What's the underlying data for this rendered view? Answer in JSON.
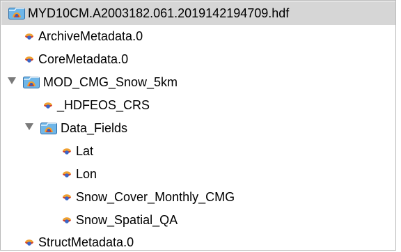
{
  "tree": {
    "items": [
      {
        "label": "MYD10CM.A2003182.061.2019142194709.hdf",
        "type": "file",
        "selected": true
      },
      {
        "label": "ArchiveMetadata.0",
        "type": "attribute"
      },
      {
        "label": "CoreMetadata.0",
        "type": "attribute"
      },
      {
        "label": "MOD_CMG_Snow_5km",
        "type": "group",
        "expanded": true
      },
      {
        "label": "_HDFEOS_CRS",
        "type": "attribute"
      },
      {
        "label": "Data_Fields",
        "type": "group",
        "expanded": true
      },
      {
        "label": "Lat",
        "type": "variable"
      },
      {
        "label": "Lon",
        "type": "variable"
      },
      {
        "label": "Snow_Cover_Monthly_CMG",
        "type": "variable"
      },
      {
        "label": "Snow_Spatial_QA",
        "type": "variable"
      },
      {
        "label": "StructMetadata.0",
        "type": "attribute"
      }
    ]
  },
  "icons": {
    "file": "dataset-file-icon",
    "group": "group-folder-icon",
    "variable": "variable-icon",
    "collapse": "disclosure-triangle-expanded-icon"
  },
  "colors": {
    "selection": "#d6d6d6",
    "border": "#b9b9b9",
    "disclosure": "#7a7a7a"
  }
}
